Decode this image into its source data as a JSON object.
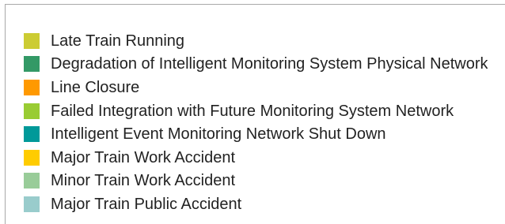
{
  "legend": {
    "items": [
      {
        "label": "Late Train Running",
        "color": "#cccc33"
      },
      {
        "label": "Degradation of Intelligent Monitoring System Physical Network",
        "color": "#339966"
      },
      {
        "label": "Line Closure",
        "color": "#ff9900"
      },
      {
        "label": "Failed Integration with Future Monitoring System Network",
        "color": "#99cc33"
      },
      {
        "label": "Intelligent Event Monitoring Network Shut Down",
        "color": "#009999"
      },
      {
        "label": "Major Train Work Accident",
        "color": "#ffcc00"
      },
      {
        "label": "Minor Train Work Accident",
        "color": "#99cc99"
      },
      {
        "label": "Major Train Public Accident",
        "color": "#99cccc"
      }
    ]
  }
}
